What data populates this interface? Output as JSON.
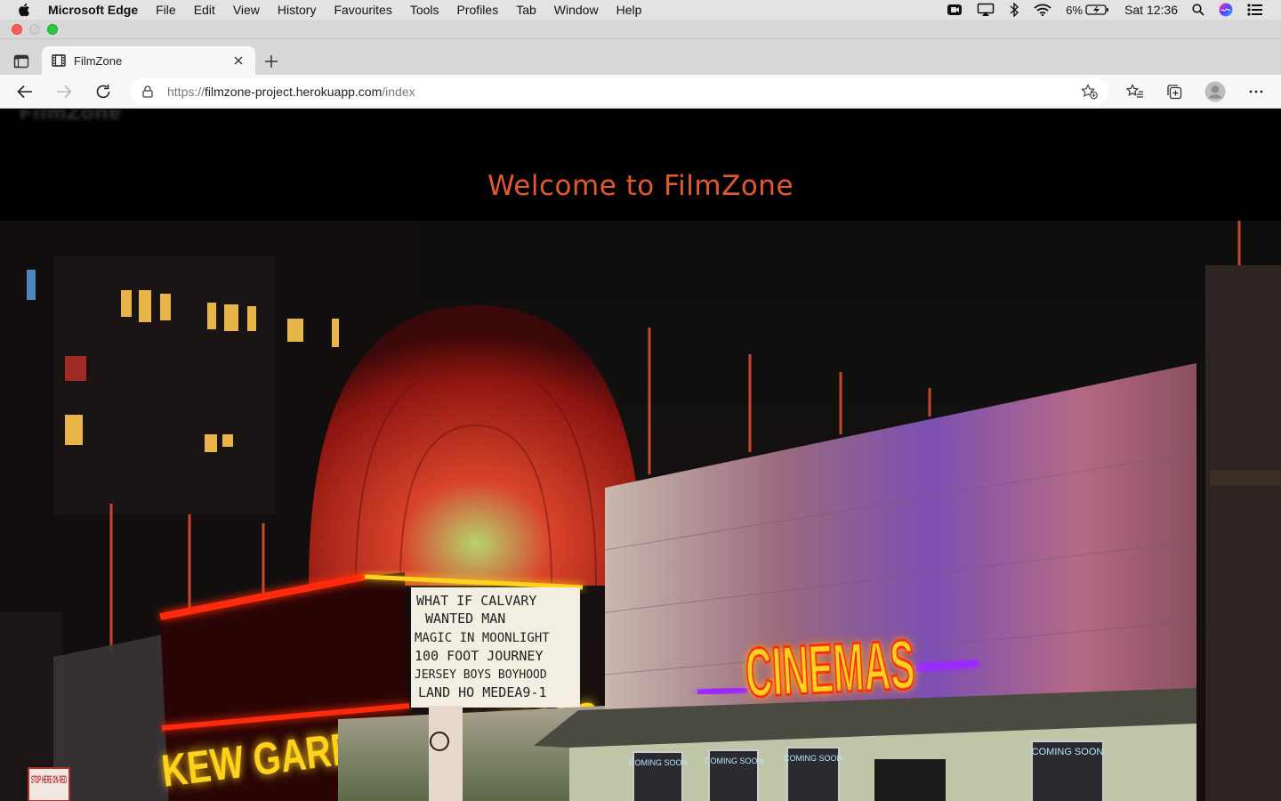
{
  "menubar": {
    "app_name": "Microsoft Edge",
    "items": [
      "File",
      "Edit",
      "View",
      "History",
      "Favourites",
      "Tools",
      "Profiles",
      "Tab",
      "Window",
      "Help"
    ],
    "battery": "6%",
    "clock": "Sat 12:36"
  },
  "browser": {
    "tab_title": "FilmZone",
    "url_prefix": "https://",
    "url_host": "filmzone-project.herokuapp.com",
    "url_path": "/index"
  },
  "page": {
    "heading": "Welcome to FilmZone",
    "brand": "FilmZone",
    "marquee_left": "KEW GARDENS CINEMAS",
    "marquee_board": [
      "WHAT IF    CALVARY",
      "WANTED MAN",
      "MAGIC IN MOONLIGHT",
      "100 FOOT JOURNEY",
      "JERSEY BOYS BOYHOOD",
      "LAND HO    MEDEA9-1"
    ],
    "marquee_right": "CINEMAS",
    "stop_sign": "STOP HERE ON RED",
    "poster_label": "COMING SOON"
  },
  "colors": {
    "heading": "#e2592e",
    "neon_red": "#ff2a10",
    "neon_yellow": "#ffd21a",
    "neon_blue": "#3b63ff",
    "neon_purple": "#9b2cff"
  }
}
